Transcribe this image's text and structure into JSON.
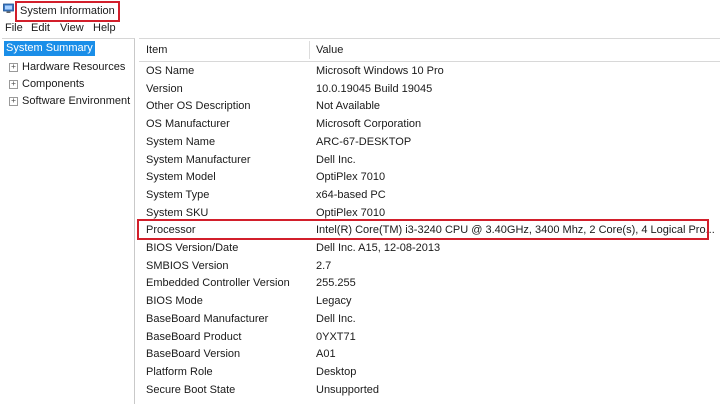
{
  "window": {
    "title": "System Information"
  },
  "menu": [
    "File",
    "Edit",
    "View",
    "Help"
  ],
  "tree": {
    "selected": "System Summary",
    "items": [
      "Hardware Resources",
      "Components",
      "Software Environment"
    ],
    "expander_symbol": "+"
  },
  "table": {
    "headers": {
      "item": "Item",
      "value": "Value"
    },
    "rows": [
      {
        "item": "OS Name",
        "value": "Microsoft Windows 10 Pro"
      },
      {
        "item": "Version",
        "value": "10.0.19045 Build 19045"
      },
      {
        "item": "Other OS Description",
        "value": "Not Available"
      },
      {
        "item": "OS Manufacturer",
        "value": "Microsoft Corporation"
      },
      {
        "item": "System Name",
        "value": "ARC-67-DESKTOP"
      },
      {
        "item": "System Manufacturer",
        "value": "Dell Inc."
      },
      {
        "item": "System Model",
        "value": "OptiPlex 7010"
      },
      {
        "item": "System Type",
        "value": "x64-based PC"
      },
      {
        "item": "System SKU",
        "value": "OptiPlex 7010"
      },
      {
        "item": "Processor",
        "value": "Intel(R) Core(TM) i3-3240 CPU @ 3.40GHz, 3400 Mhz, 2 Core(s), 4 Logical Pro..."
      },
      {
        "item": "BIOS Version/Date",
        "value": "Dell Inc. A15, 12-08-2013"
      },
      {
        "item": "SMBIOS Version",
        "value": "2.7"
      },
      {
        "item": "Embedded Controller Version",
        "value": "255.255"
      },
      {
        "item": "BIOS Mode",
        "value": "Legacy"
      },
      {
        "item": "BaseBoard Manufacturer",
        "value": "Dell Inc."
      },
      {
        "item": "BaseBoard Product",
        "value": "0YXT71"
      },
      {
        "item": "BaseBoard Version",
        "value": "A01"
      },
      {
        "item": "Platform Role",
        "value": "Desktop"
      },
      {
        "item": "Secure Boot State",
        "value": "Unsupported"
      }
    ]
  },
  "colors": {
    "highlight": "#d21f2b",
    "selection": "#1a8ee8"
  }
}
